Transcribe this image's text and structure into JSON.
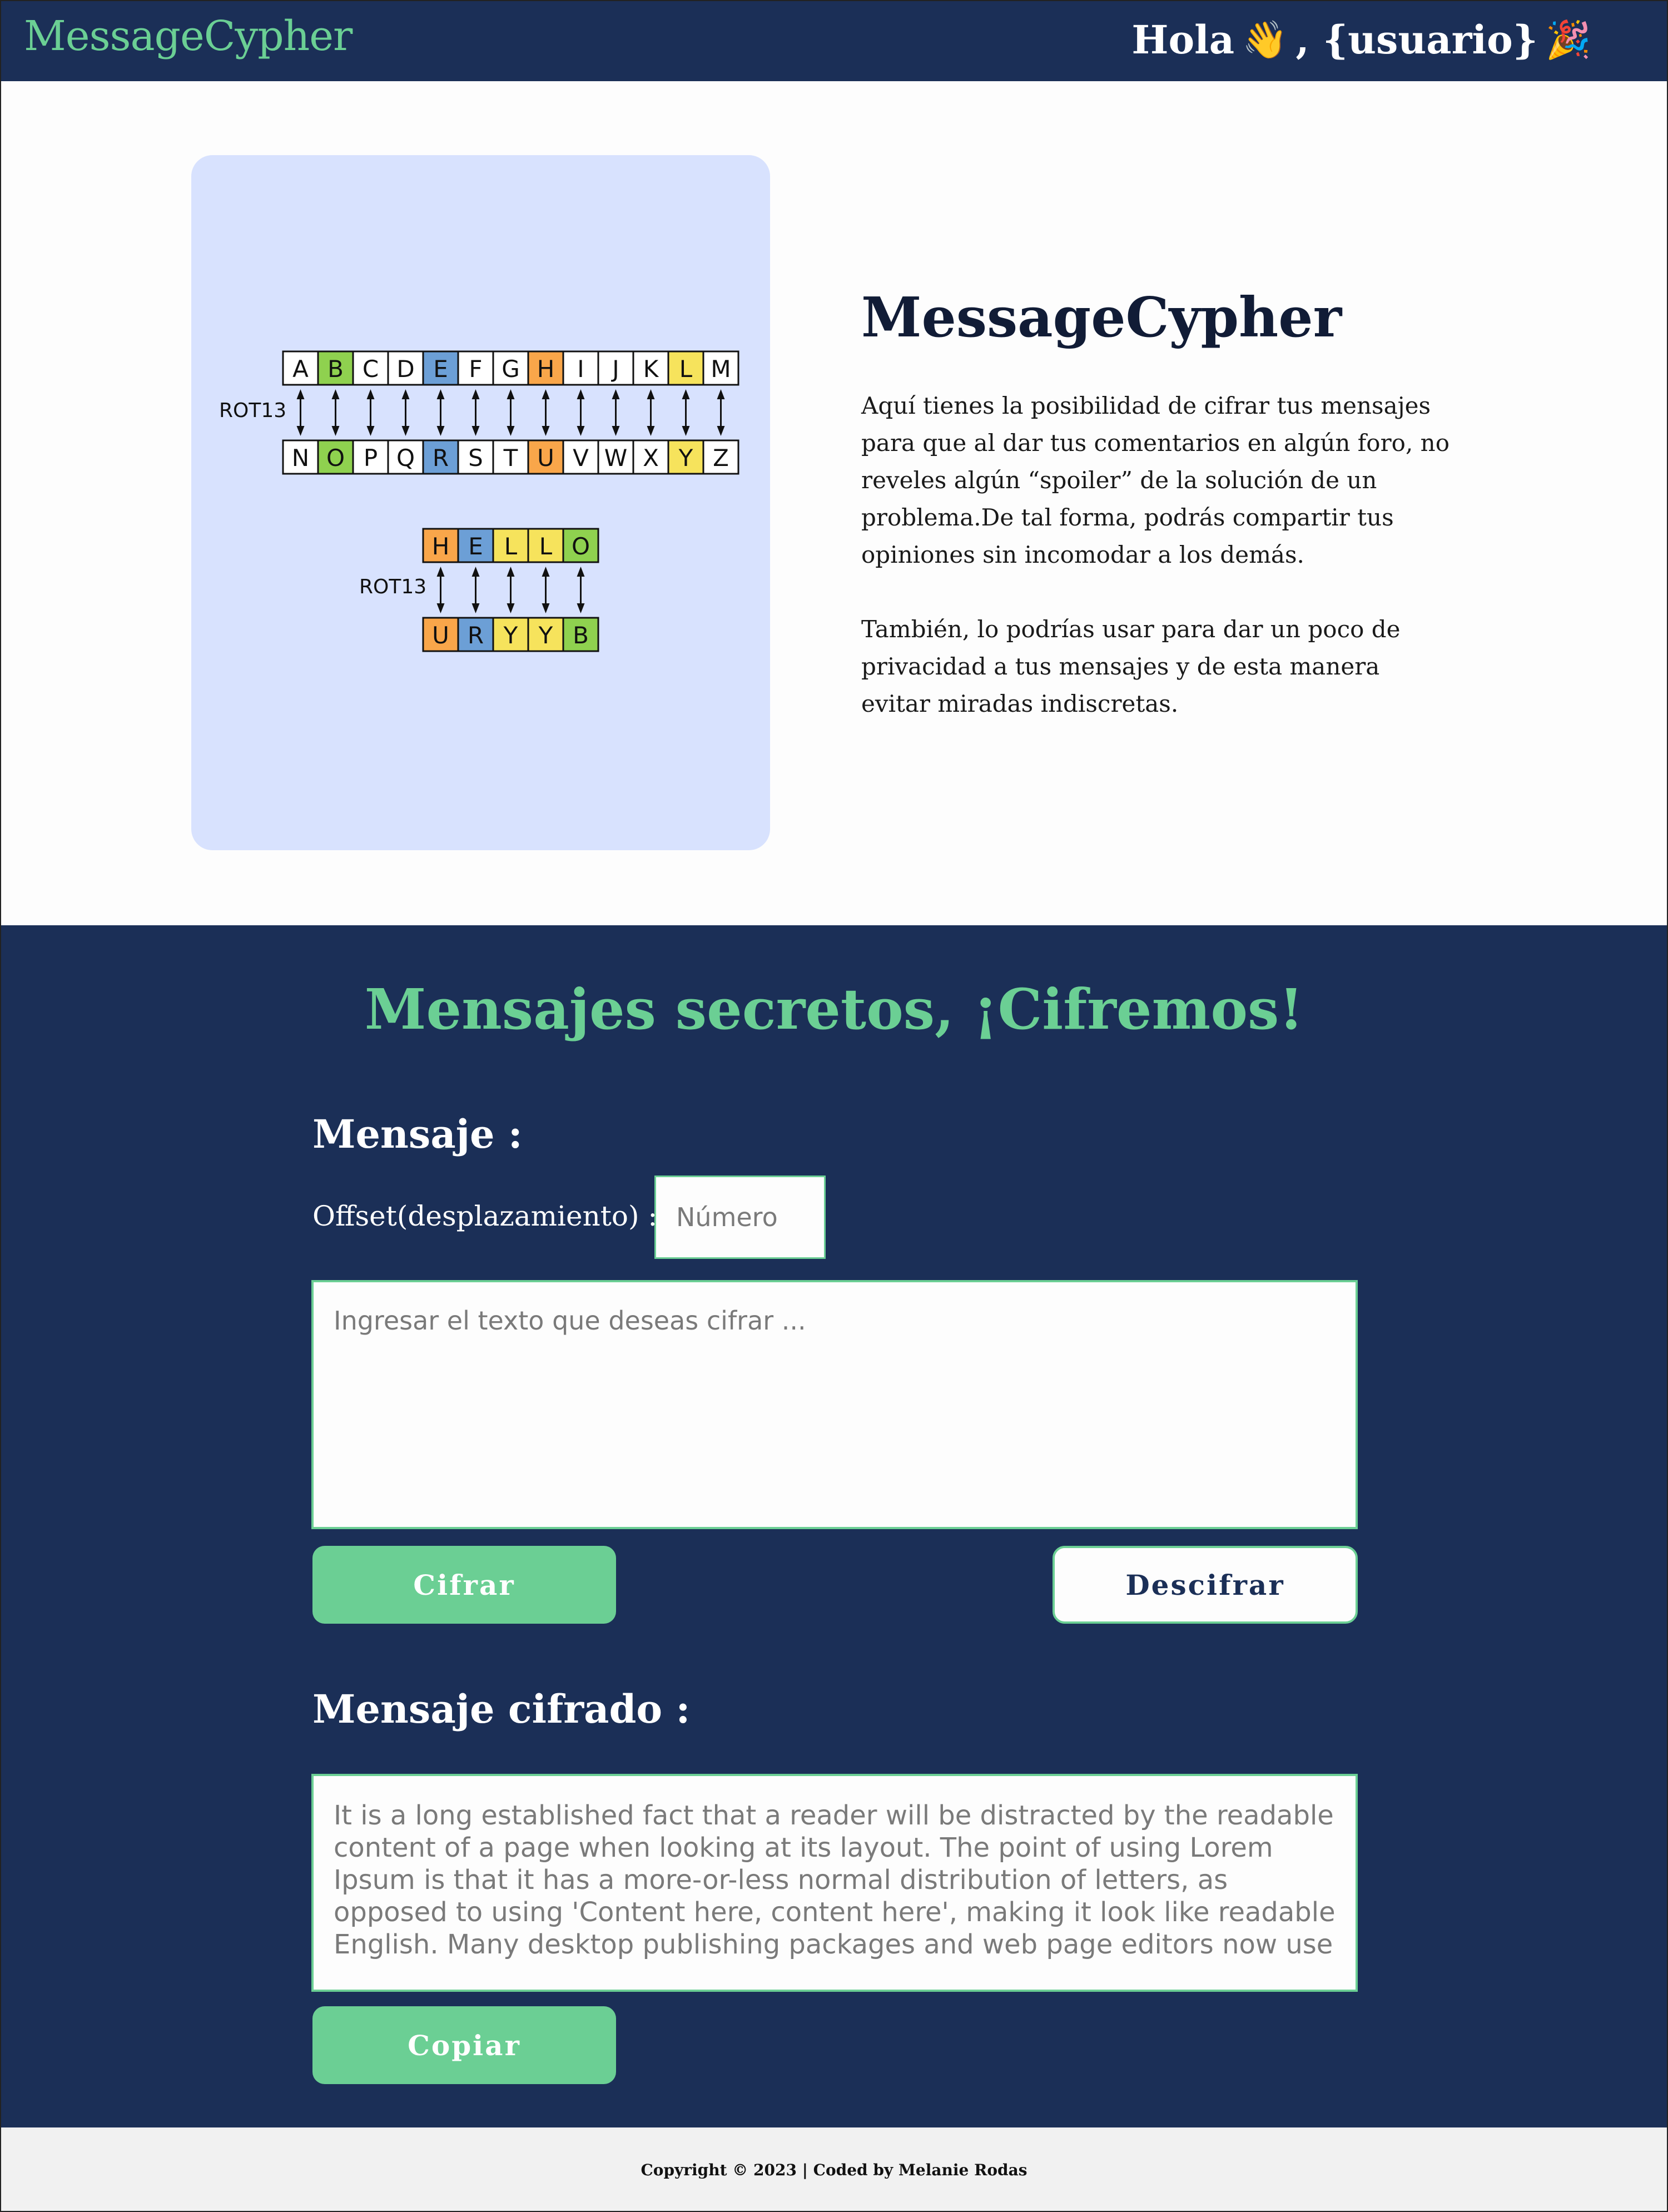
{
  "header": {
    "brand": "MessageCypher",
    "greeting": "Hola",
    "greeting_icon": "👋",
    "username": ", {usuario}",
    "party_icon": "🎉"
  },
  "hero": {
    "title": "MessageCypher",
    "paragraphs": [
      "Aquí tienes la posibilidad de cifrar tus mensajes para que al dar tus comentarios en algún foro, no reveles algún “spoiler” de la solución de un problema.De tal forma, podrás compartir tus opiniones sin incomodar a los demás.",
      " También, lo podrías usar para dar un poco de privacidad a tus mensajes y de esta  manera evitar miradas indiscretas."
    ],
    "illustration": {
      "alphabet_top": [
        "A",
        "B",
        "C",
        "D",
        "E",
        "F",
        "G",
        "H",
        "I",
        "J",
        "K",
        "L",
        "M"
      ],
      "alphabet_bottom": [
        "N",
        "O",
        "P",
        "Q",
        "R",
        "S",
        "T",
        "U",
        "V",
        "W",
        "X",
        "Y",
        "Z"
      ],
      "alphabet_colors": [
        "",
        "#8fd14f",
        "",
        "",
        "#6c9fd6",
        "",
        "",
        "#f9a64a",
        "",
        "",
        "",
        "#f6e35c",
        ""
      ],
      "rot_label": "ROT13",
      "word_top": [
        "H",
        "E",
        "L",
        "L",
        "O"
      ],
      "word_bottom": [
        "U",
        "R",
        "Y",
        "Y",
        "B"
      ],
      "word_colors": [
        "#f9a64a",
        "#6c9fd6",
        "#f6e35c",
        "#f6e35c",
        "#8fd14f"
      ]
    }
  },
  "cipher": {
    "title": "Mensajes secretos, ¡Cifremos!",
    "message_label": "Mensaje :",
    "offset_label": "Offset(desplazamiento) :",
    "offset_placeholder": "Número",
    "message_placeholder": "Ingresar el texto  que deseas cifrar ...",
    "encrypt_button": "Cifrar",
    "decrypt_button": "Descifrar",
    "output_label": "Mensaje cifrado :",
    "output_text": "It is a long established fact that a reader will be distracted by the readable content of a page when looking at its layout. The point of using Lorem Ipsum is that it has a more-or-less normal distribution of letters, as opposed to using 'Content here, content here', making it look like readable English. Many desktop publishing packages and web page editors now use",
    "copy_button": "Copiar"
  },
  "footer": {
    "text": "Copyright © 2023 | Coded by Melanie Rodas"
  },
  "colors": {
    "navy": "#1b2f57",
    "accent_green": "#6bcf94",
    "illustration_bg": "#d8e2fe"
  }
}
